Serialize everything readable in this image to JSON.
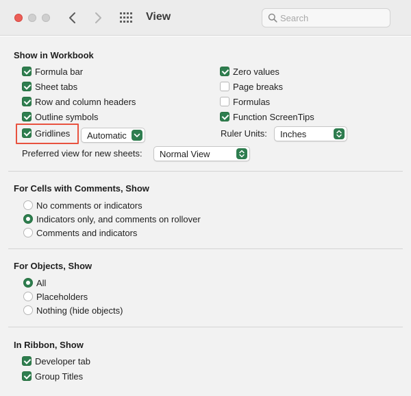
{
  "window": {
    "title": "View"
  },
  "search": {
    "placeholder": "Search"
  },
  "workbook": {
    "heading": "Show in Workbook",
    "left_checks": [
      {
        "label": "Formula bar",
        "checked": true
      },
      {
        "label": "Sheet tabs",
        "checked": true
      },
      {
        "label": "Row and column headers",
        "checked": true
      },
      {
        "label": "Outline symbols",
        "checked": true
      },
      {
        "label": "Gridlines",
        "checked": true
      }
    ],
    "right_checks": [
      {
        "label": "Zero values",
        "checked": true
      },
      {
        "label": "Page breaks",
        "checked": false
      },
      {
        "label": "Formulas",
        "checked": false
      },
      {
        "label": "Function ScreenTips",
        "checked": true
      }
    ],
    "gridline_color": "Automatic",
    "ruler_units_label": "Ruler Units:",
    "ruler_units_value": "Inches",
    "preferred_view_label": "Preferred view for new sheets:",
    "preferred_view_value": "Normal View"
  },
  "comments": {
    "heading": "For Cells with Comments, Show",
    "options": [
      {
        "label": "No comments or indicators",
        "selected": false
      },
      {
        "label": "Indicators only, and comments on rollover",
        "selected": true
      },
      {
        "label": "Comments and indicators",
        "selected": false
      }
    ]
  },
  "objects": {
    "heading": "For Objects, Show",
    "options": [
      {
        "label": "All",
        "selected": true
      },
      {
        "label": "Placeholders",
        "selected": false
      },
      {
        "label": "Nothing (hide objects)",
        "selected": false
      }
    ]
  },
  "ribbon": {
    "heading": "In Ribbon, Show",
    "checks": [
      {
        "label": "Developer tab",
        "checked": true
      },
      {
        "label": "Group Titles",
        "checked": true
      }
    ]
  },
  "colors": {
    "accent": "#2e7d4f",
    "highlight": "#e8523f",
    "close": "#ec5f58"
  }
}
